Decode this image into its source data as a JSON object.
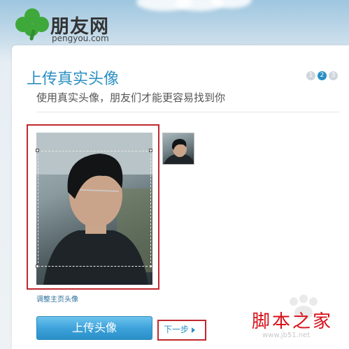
{
  "brand": {
    "name_cn": "朋友网",
    "domain": "pengyou.com",
    "accent": "#3ea83b"
  },
  "page": {
    "title": "上传真实头像",
    "subtitle": "使用真实头像，朋友们才能更容易找到你",
    "steps": [
      "1",
      "2",
      "3"
    ],
    "active_step": 2,
    "accent": "#2a8fc3"
  },
  "avatar": {
    "caption": "调整主页头像"
  },
  "actions": {
    "upload_label": "上传头像",
    "next_label": "下一步"
  },
  "watermark": {
    "cn": "脚本之家",
    "url": "www.jb51.net",
    "color": "#d8101a"
  },
  "icons": [
    "clover-logo-icon",
    "arrow-right-icon"
  ]
}
